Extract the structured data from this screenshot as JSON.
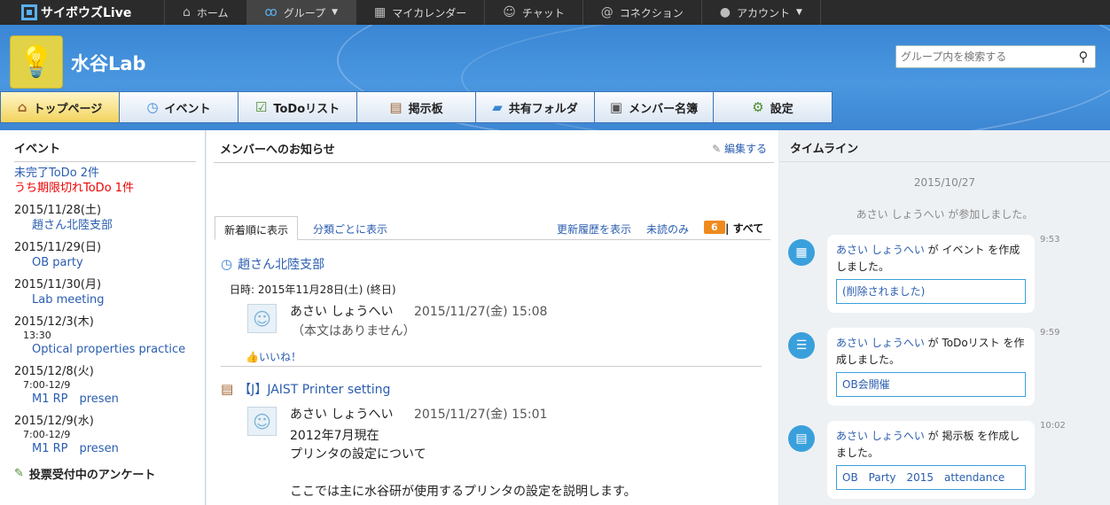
{
  "topbar": {
    "brand": "サイボウズLive",
    "nav": [
      {
        "label": "ホーム",
        "icon": "home-icon"
      },
      {
        "label": "グループ",
        "icon": "group-icon"
      },
      {
        "label": "マイカレンダー",
        "icon": "calendar-icon"
      },
      {
        "label": "チャット",
        "icon": "chat-icon"
      },
      {
        "label": "コネクション",
        "icon": "at-icon"
      },
      {
        "label": "アカウント",
        "icon": "person-icon"
      }
    ]
  },
  "banner": {
    "group_name": "水谷Lab",
    "search_placeholder": "グループ内を検索する"
  },
  "tabs": [
    {
      "label": "トップページ",
      "icon": "home-icon"
    },
    {
      "label": "イベント",
      "icon": "event-icon"
    },
    {
      "label": "ToDoリスト",
      "icon": "todo-icon"
    },
    {
      "label": "掲示板",
      "icon": "board-icon"
    },
    {
      "label": "共有フォルダ",
      "icon": "folder-icon"
    },
    {
      "label": "メンバー名簿",
      "icon": "member-icon"
    },
    {
      "label": "設定",
      "icon": "gear-icon"
    }
  ],
  "left": {
    "title": "イベント",
    "todo_incomplete": "未完了ToDo 2件",
    "todo_overdue": "うち期限切れToDo 1件",
    "events": [
      {
        "date": "2015/11/28(土)",
        "time": "",
        "title": "趙さん北陸支部"
      },
      {
        "date": "2015/11/29(日)",
        "time": "",
        "title": "OB party"
      },
      {
        "date": "2015/11/30(月)",
        "time": "",
        "title": "Lab meeting"
      },
      {
        "date": "2015/12/3(木)",
        "time": "13:30",
        "title": "Optical properties practice"
      },
      {
        "date": "2015/12/8(火)",
        "time": "7:00-12/9",
        "title": "M1 RP　presen"
      },
      {
        "date": "2015/12/9(水)",
        "time": "7:00-12/9",
        "title": "M1 RP　presen"
      }
    ],
    "survey_title": "投票受付中のアンケート"
  },
  "middle": {
    "title": "メンバーへのお知らせ",
    "edit": "編集する",
    "tab_new": "新着順に表示",
    "tab_category": "分類ごとに表示",
    "history": "更新履歴を表示",
    "unread_only": "未読のみ",
    "unread_count": "6",
    "separator": "|",
    "all": "すべて",
    "post1": {
      "title": "趙さん北陸支部",
      "date_label": "日時:",
      "date_value": "2015年11月28日(土) (終日)",
      "author": "あさい しょうへい",
      "timestamp": "2015/11/27(金) 15:08",
      "body": "（本文はありません）",
      "like": "いいね！"
    },
    "post2": {
      "title": "【J】JAIST Printer setting",
      "author": "あさい しょうへい",
      "timestamp": "2015/11/27(金) 15:01",
      "body_line1": "2012年7月現在",
      "body_line2": "プリンタの設定について",
      "body_line3": "ここでは主に水谷研が使用するプリンタの設定を説明します。"
    }
  },
  "timeline": {
    "title": "タイムライン",
    "date": "2015/10/27",
    "join_msg": "あさい しょうへい が参加しました。",
    "items": [
      {
        "author": "あさい しょうへい",
        "text1": " が イベント を作成",
        "text2": "しました。",
        "link": "(削除されました)",
        "time": "9:53",
        "icon": "calendar-icon"
      },
      {
        "author": "あさい しょうへい",
        "text1": " が ToDoリスト を作",
        "text2": "成しました。",
        "link": "OB会開催",
        "time": "9:59",
        "icon": "checklist-icon"
      },
      {
        "author": "あさい しょうへい",
        "text1": " が 掲示板 を作成し",
        "text2": "ました。",
        "link": "OB　Party　2015　attendance",
        "time": "10:02",
        "icon": "clipboard-icon"
      }
    ]
  }
}
